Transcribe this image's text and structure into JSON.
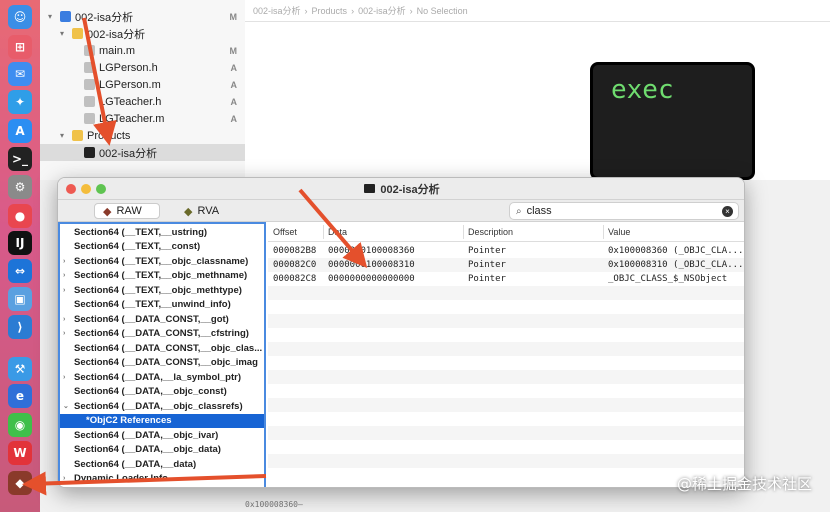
{
  "colors": {
    "accent": "#1764d4",
    "arrow": "#e4502c",
    "exec_text": "#6fdc6f"
  },
  "dock": {
    "icons": [
      {
        "name": "finder-icon",
        "glyph": "☺",
        "bg": "#3a8ee6"
      },
      {
        "name": "launchpad-icon",
        "glyph": "⊞",
        "bg": "#e85c6a"
      },
      {
        "name": "mail-icon",
        "glyph": "✉",
        "bg": "#3d8df0"
      },
      {
        "name": "safari-icon",
        "glyph": "✦",
        "bg": "#2f9ee8"
      },
      {
        "name": "app-store-icon",
        "glyph": "A",
        "bg": "#2b8ef2"
      },
      {
        "name": "terminal-icon",
        "glyph": ">_",
        "bg": "#222222"
      },
      {
        "name": "system-preferences-icon",
        "glyph": "⚙",
        "bg": "#8a8a8a"
      },
      {
        "name": "qq-icon",
        "glyph": "●",
        "bg": "#e9464f"
      },
      {
        "name": "intellij-icon",
        "glyph": "IJ",
        "bg": "#111111"
      },
      {
        "name": "teamviewer-icon",
        "glyph": "⇔",
        "bg": "#1d74d8"
      },
      {
        "name": "preview-icon",
        "glyph": "▣",
        "bg": "#5aa0e0"
      },
      {
        "name": "vscode-icon",
        "glyph": "⟩",
        "bg": "#2b7cd3"
      },
      {
        "name": "xcode-icon",
        "glyph": "⚒",
        "bg": "#3a9ae6"
      },
      {
        "name": "eudic-icon",
        "glyph": "e",
        "bg": "#2f6fd8"
      },
      {
        "name": "wechat-icon",
        "glyph": "◉",
        "bg": "#3fbf4a"
      },
      {
        "name": "wps-icon",
        "glyph": "W",
        "bg": "#e2333a"
      },
      {
        "name": "machoview-icon",
        "glyph": "◆",
        "bg": "#8a3a2a"
      }
    ]
  },
  "navigator": {
    "rows": [
      {
        "label": "002-isa分析",
        "status": "M",
        "indent": 0,
        "disclosure": "▾",
        "icon_color": "#3a7de0"
      },
      {
        "label": "002-isa分析",
        "status": "",
        "indent": 1,
        "disclosure": "▾",
        "icon_color": "#f0c24a"
      },
      {
        "label": "main.m",
        "status": "M",
        "indent": 2,
        "disclosure": "",
        "icon_color": "#c0c0c0"
      },
      {
        "label": "LGPerson.h",
        "status": "A",
        "indent": 2,
        "disclosure": "",
        "icon_color": "#c0c0c0"
      },
      {
        "label": "LGPerson.m",
        "status": "A",
        "indent": 2,
        "disclosure": "",
        "icon_color": "#c0c0c0"
      },
      {
        "label": "LGTeacher.h",
        "status": "A",
        "indent": 2,
        "disclosure": "",
        "icon_color": "#c0c0c0"
      },
      {
        "label": "LGTeacher.m",
        "status": "A",
        "indent": 2,
        "disclosure": "",
        "icon_color": "#c0c0c0"
      },
      {
        "label": "Products",
        "status": "",
        "indent": 1,
        "disclosure": "▾",
        "icon_color": "#f0c24a"
      },
      {
        "label": "002-isa分析",
        "status": "",
        "indent": 2,
        "disclosure": "",
        "icon_color": "#222222"
      }
    ]
  },
  "jump_bar": {
    "items": [
      "002-isa分析",
      "Products",
      "002-isa分析",
      "No Selection"
    ]
  },
  "exec": {
    "text": "exec"
  },
  "console": {
    "text": "0x100008360—"
  },
  "macho": {
    "title": "002-isa分析",
    "modes": [
      {
        "label": "RAW",
        "active": true
      },
      {
        "label": "RVA",
        "active": false
      }
    ],
    "search": {
      "value": "class"
    },
    "outline": [
      {
        "label": "Section64 (__TEXT,__ustring)",
        "tri": "",
        "indent": 0,
        "selected": false
      },
      {
        "label": "Section64 (__TEXT,__const)",
        "tri": "",
        "indent": 0,
        "selected": false
      },
      {
        "label": "Section64 (__TEXT,__objc_classname)",
        "tri": "›",
        "indent": 0,
        "selected": false
      },
      {
        "label": "Section64 (__TEXT,__objc_methname)",
        "tri": "›",
        "indent": 0,
        "selected": false
      },
      {
        "label": "Section64 (__TEXT,__objc_methtype)",
        "tri": "›",
        "indent": 0,
        "selected": false
      },
      {
        "label": "Section64 (__TEXT,__unwind_info)",
        "tri": "",
        "indent": 0,
        "selected": false
      },
      {
        "label": "Section64 (__DATA_CONST,__got)",
        "tri": "›",
        "indent": 0,
        "selected": false
      },
      {
        "label": "Section64 (__DATA_CONST,__cfstring)",
        "tri": "›",
        "indent": 0,
        "selected": false
      },
      {
        "label": "Section64 (__DATA_CONST,__objc_clas...",
        "tri": "",
        "indent": 0,
        "selected": false
      },
      {
        "label": "Section64 (__DATA_CONST,__objc_imag",
        "tri": "",
        "indent": 0,
        "selected": false
      },
      {
        "label": "Section64 (__DATA,__la_symbol_ptr)",
        "tri": "›",
        "indent": 0,
        "selected": false
      },
      {
        "label": "Section64 (__DATA,__objc_const)",
        "tri": "",
        "indent": 0,
        "selected": false
      },
      {
        "label": "Section64 (__DATA,__objc_classrefs)",
        "tri": "⌄",
        "indent": 0,
        "selected": false
      },
      {
        "label": "*ObjC2 References",
        "tri": "",
        "indent": 1,
        "selected": true
      },
      {
        "label": "Section64 (__DATA,__objc_ivar)",
        "tri": "",
        "indent": 0,
        "selected": false
      },
      {
        "label": "Section64 (__DATA,__objc_data)",
        "tri": "",
        "indent": 0,
        "selected": false
      },
      {
        "label": "Section64 (__DATA,__data)",
        "tri": "",
        "indent": 0,
        "selected": false
      },
      {
        "label": "Dynamic Loader Info",
        "tri": "›",
        "indent": 0,
        "selected": false
      }
    ],
    "table": {
      "headers": [
        "Offset",
        "Data",
        "Description",
        "Value"
      ],
      "rows": [
        {
          "offset": "000082B8",
          "data": "0000000100008360",
          "description": "Pointer",
          "value": "0x100008360 (_OBJC_CLA..."
        },
        {
          "offset": "000082C0",
          "data": "0000000100008310",
          "description": "Pointer",
          "value": "0x100008310 (_OBJC_CLA..."
        },
        {
          "offset": "000082C8",
          "data": "0000000000000000",
          "description": "Pointer",
          "value": "_OBJC_CLASS_$_NSObject"
        }
      ]
    }
  },
  "watermark": {
    "text": "@稀土掘金技术社区"
  }
}
